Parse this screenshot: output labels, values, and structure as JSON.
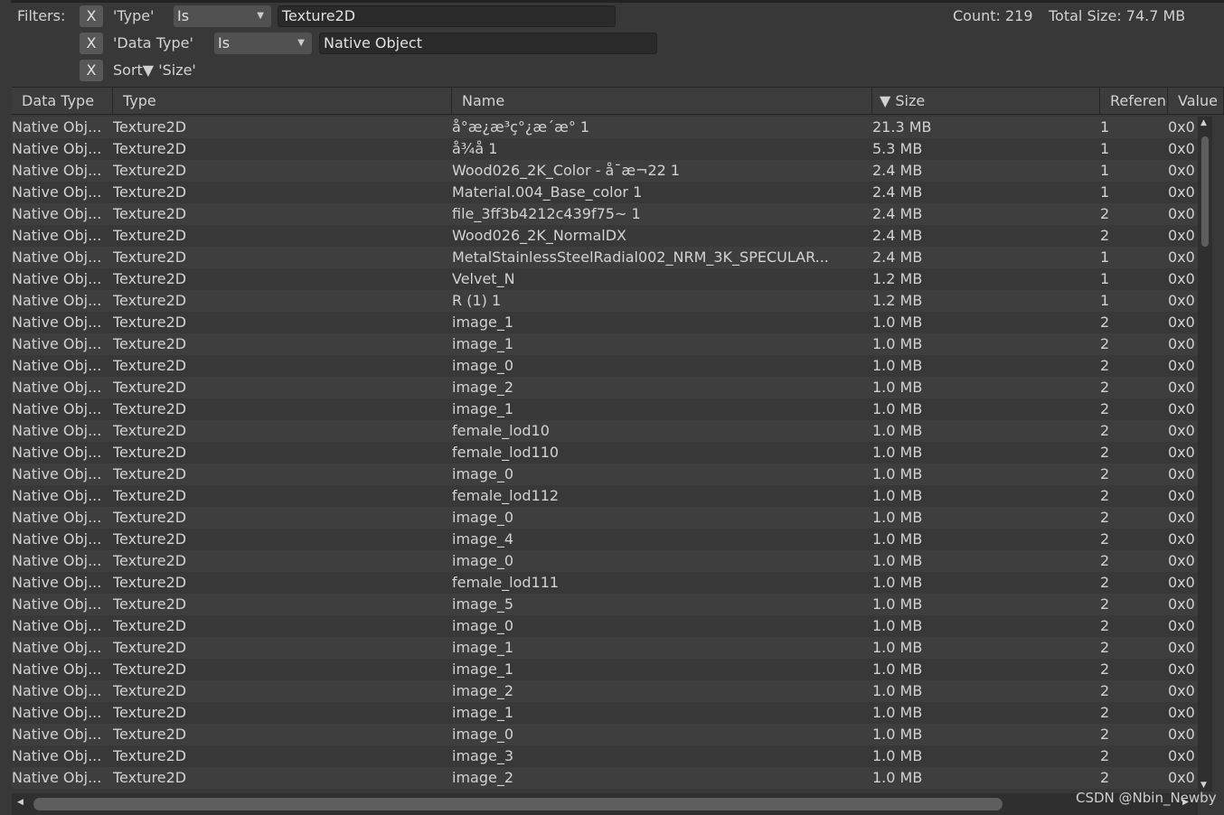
{
  "filters": {
    "label": "Filters:",
    "remove_label": "X",
    "type_filter": {
      "field": "'Type'",
      "op": "Is",
      "value": "Texture2D"
    },
    "datatype_filter": {
      "field": "'Data Type'",
      "op": "Is",
      "value": "Native Object"
    },
    "sort_filter": {
      "label": "Sort▼ 'Size'"
    }
  },
  "summary": {
    "count": "Count: 219",
    "total": "Total Size: 74.7 MB"
  },
  "columns": [
    "Data Type",
    "Type",
    "Name",
    "▼ Size",
    "References",
    "Value"
  ],
  "rows": [
    [
      "Native Obj...",
      "Texture2D",
      "å°æ¿æ³ç°¿æ´æ° 1",
      "21.3 MB",
      "1",
      "0x0"
    ],
    [
      "Native Obj...",
      "Texture2D",
      "å¾å 1",
      "5.3 MB",
      "1",
      "0x0"
    ],
    [
      "Native Obj...",
      "Texture2D",
      "Wood026_2K_Color - å¯æ¬22 1",
      "2.4 MB",
      "1",
      "0x0"
    ],
    [
      "Native Obj...",
      "Texture2D",
      "Material.004_Base_color 1",
      "2.4 MB",
      "1",
      "0x0"
    ],
    [
      "Native Obj...",
      "Texture2D",
      "file_3ff3b4212c439f75~ 1",
      "2.4 MB",
      "2",
      "0x0"
    ],
    [
      "Native Obj...",
      "Texture2D",
      "Wood026_2K_NormalDX",
      "2.4 MB",
      "2",
      "0x0"
    ],
    [
      "Native Obj...",
      "Texture2D",
      "MetalStainlessSteelRadial002_NRM_3K_SPECULAR...",
      "2.4 MB",
      "1",
      "0x0"
    ],
    [
      "Native Obj...",
      "Texture2D",
      "Velvet_N",
      "1.2 MB",
      "1",
      "0x0"
    ],
    [
      "Native Obj...",
      "Texture2D",
      "R (1) 1",
      "1.2 MB",
      "1",
      "0x0"
    ],
    [
      "Native Obj...",
      "Texture2D",
      "image_1",
      "1.0 MB",
      "2",
      "0x0"
    ],
    [
      "Native Obj...",
      "Texture2D",
      "image_1",
      "1.0 MB",
      "2",
      "0x0"
    ],
    [
      "Native Obj...",
      "Texture2D",
      "image_0",
      "1.0 MB",
      "2",
      "0x0"
    ],
    [
      "Native Obj...",
      "Texture2D",
      "image_2",
      "1.0 MB",
      "2",
      "0x0"
    ],
    [
      "Native Obj...",
      "Texture2D",
      "image_1",
      "1.0 MB",
      "2",
      "0x0"
    ],
    [
      "Native Obj...",
      "Texture2D",
      "female_lod10",
      "1.0 MB",
      "2",
      "0x0"
    ],
    [
      "Native Obj...",
      "Texture2D",
      "female_lod110",
      "1.0 MB",
      "2",
      "0x0"
    ],
    [
      "Native Obj...",
      "Texture2D",
      "image_0",
      "1.0 MB",
      "2",
      "0x0"
    ],
    [
      "Native Obj...",
      "Texture2D",
      "female_lod112",
      "1.0 MB",
      "2",
      "0x0"
    ],
    [
      "Native Obj...",
      "Texture2D",
      "image_0",
      "1.0 MB",
      "2",
      "0x0"
    ],
    [
      "Native Obj...",
      "Texture2D",
      "image_4",
      "1.0 MB",
      "2",
      "0x0"
    ],
    [
      "Native Obj...",
      "Texture2D",
      "image_0",
      "1.0 MB",
      "2",
      "0x0"
    ],
    [
      "Native Obj...",
      "Texture2D",
      "female_lod111",
      "1.0 MB",
      "2",
      "0x0"
    ],
    [
      "Native Obj...",
      "Texture2D",
      "image_5",
      "1.0 MB",
      "2",
      "0x0"
    ],
    [
      "Native Obj...",
      "Texture2D",
      "image_0",
      "1.0 MB",
      "2",
      "0x0"
    ],
    [
      "Native Obj...",
      "Texture2D",
      "image_1",
      "1.0 MB",
      "2",
      "0x0"
    ],
    [
      "Native Obj...",
      "Texture2D",
      "image_1",
      "1.0 MB",
      "2",
      "0x0"
    ],
    [
      "Native Obj...",
      "Texture2D",
      "image_2",
      "1.0 MB",
      "2",
      "0x0"
    ],
    [
      "Native Obj...",
      "Texture2D",
      "image_1",
      "1.0 MB",
      "2",
      "0x0"
    ],
    [
      "Native Obj...",
      "Texture2D",
      "image_0",
      "1.0 MB",
      "2",
      "0x0"
    ],
    [
      "Native Obj...",
      "Texture2D",
      "image_3",
      "1.0 MB",
      "2",
      "0x0"
    ],
    [
      "Native Obj...",
      "Texture2D",
      "image_2",
      "1.0 MB",
      "2",
      "0x0"
    ]
  ],
  "watermark": "CSDN @Nbin_Newby"
}
